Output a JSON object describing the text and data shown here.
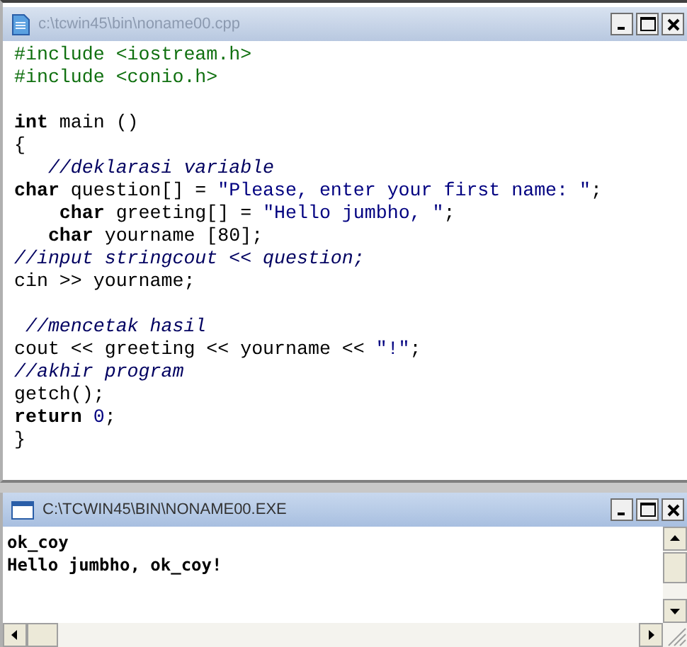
{
  "editor": {
    "title": "c:\\tcwin45\\bin\\noname00.cpp",
    "active": false,
    "lines": [
      {
        "kind": "code",
        "segments": [
          {
            "text": "#include <iostream.h>",
            "kind": "directive"
          }
        ]
      },
      {
        "kind": "code",
        "segments": [
          {
            "text": "#include <conio.h>",
            "kind": "directive"
          }
        ]
      },
      {
        "kind": "blank"
      },
      {
        "kind": "code",
        "segments": [
          {
            "text": "int",
            "kind": "keyword"
          },
          {
            "text": " main ()",
            "kind": "plain"
          }
        ]
      },
      {
        "kind": "code",
        "segments": [
          {
            "text": "{",
            "kind": "plain"
          }
        ]
      },
      {
        "kind": "code",
        "segments": [
          {
            "text": "   //deklarasi variable",
            "kind": "comment"
          }
        ]
      },
      {
        "kind": "code",
        "segments": [
          {
            "text": "char",
            "kind": "keyword"
          },
          {
            "text": " question[] = ",
            "kind": "plain"
          },
          {
            "text": "\"Please, enter your first name: \"",
            "kind": "string"
          },
          {
            "text": ";",
            "kind": "plain"
          }
        ]
      },
      {
        "kind": "code",
        "segments": [
          {
            "text": "    char",
            "kind": "keyword"
          },
          {
            "text": " greeting[] = ",
            "kind": "plain"
          },
          {
            "text": "\"Hello jumbho, \"",
            "kind": "string"
          },
          {
            "text": ";",
            "kind": "plain"
          }
        ]
      },
      {
        "kind": "code",
        "segments": [
          {
            "text": "   char",
            "kind": "keyword"
          },
          {
            "text": " yourname [80];",
            "kind": "plain"
          }
        ]
      },
      {
        "kind": "code",
        "segments": [
          {
            "text": "//input stringcout << question;",
            "kind": "comment"
          }
        ]
      },
      {
        "kind": "code",
        "segments": [
          {
            "text": "cin >> yourname;",
            "kind": "plain"
          }
        ]
      },
      {
        "kind": "blank"
      },
      {
        "kind": "code",
        "segments": [
          {
            "text": " //mencetak hasil",
            "kind": "comment"
          }
        ]
      },
      {
        "kind": "code",
        "segments": [
          {
            "text": "cout << greeting << yourname << ",
            "kind": "plain"
          },
          {
            "text": "\"!\"",
            "kind": "string"
          },
          {
            "text": ";",
            "kind": "plain"
          }
        ]
      },
      {
        "kind": "code",
        "segments": [
          {
            "text": "//akhir program",
            "kind": "comment"
          }
        ]
      },
      {
        "kind": "code",
        "segments": [
          {
            "text": "getch();",
            "kind": "plain"
          }
        ]
      },
      {
        "kind": "code",
        "segments": [
          {
            "text": "return ",
            "kind": "keyword"
          },
          {
            "text": "0",
            "kind": "number"
          },
          {
            "text": ";",
            "kind": "plain"
          }
        ]
      },
      {
        "kind": "code",
        "segments": [
          {
            "text": "}",
            "kind": "plain"
          }
        ]
      }
    ]
  },
  "console": {
    "title": "C:\\TCWIN45\\BIN\\NONAME00.EXE",
    "active": true,
    "lines": [
      "ok_coy",
      "Hello jumbho, ok_coy!"
    ]
  }
}
